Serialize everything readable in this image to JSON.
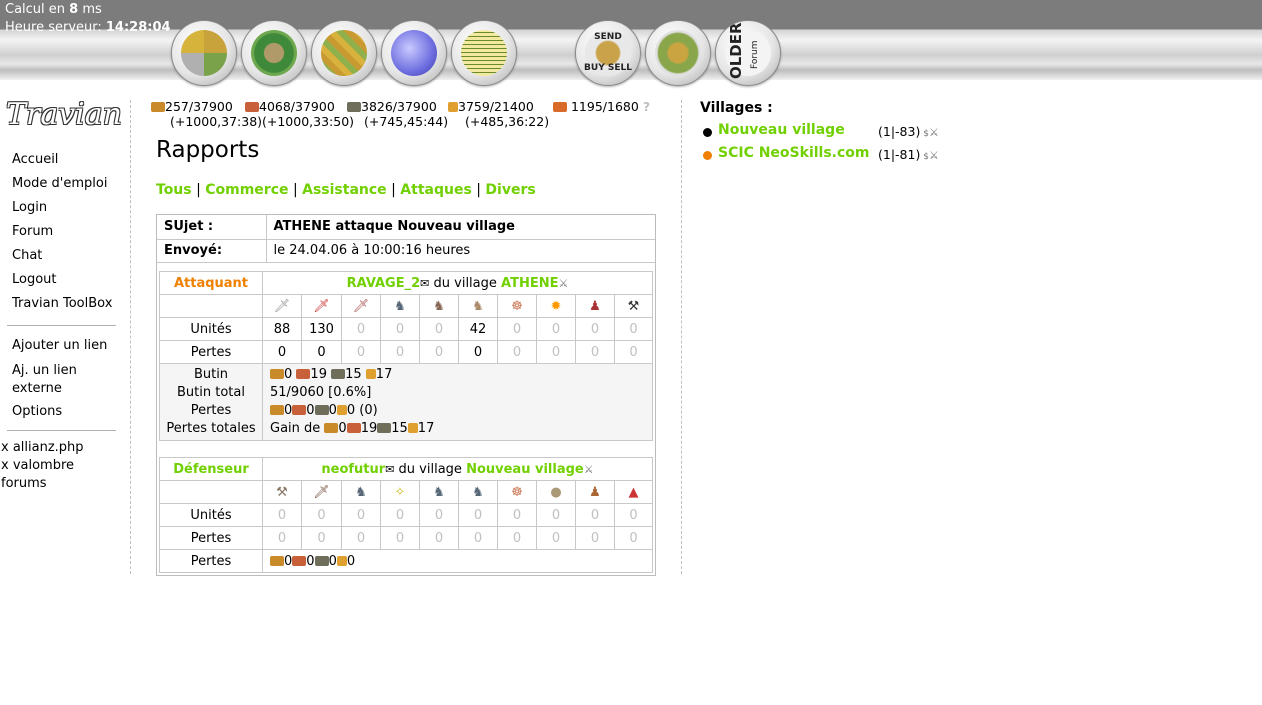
{
  "header": {
    "calc_label": "Calcul en",
    "calc_value": "8",
    "calc_unit": "ms",
    "server_time_label": "Heure serveur:",
    "server_time_value": "14:28:04",
    "nav": [
      {
        "name": "village-overview",
        "icon": "village-fields-icon"
      },
      {
        "name": "village-center",
        "icon": "village-center-icon"
      },
      {
        "name": "map",
        "icon": "map-icon"
      },
      {
        "name": "statistics",
        "icon": "statistics-icon"
      },
      {
        "name": "reports",
        "icon": "reports-icon"
      },
      {
        "name": "send-buy-sell",
        "icon": "marketplace-icon",
        "text_top": "SEND",
        "text_bottom": "BUY SELL"
      },
      {
        "name": "target-village",
        "icon": "target-village-icon"
      },
      {
        "name": "older-forum",
        "icon": "older-forum-icon",
        "text": "OLDER",
        "text2": "Forum"
      }
    ]
  },
  "sidebar": {
    "logo_text": "Travian",
    "menu": [
      "Accueil",
      "Mode d'emploi",
      "Login",
      "Forum",
      "Chat",
      "Logout",
      "Travian ToolBox"
    ],
    "menu2": [
      "Ajouter un lien",
      "Aj. un lien externe",
      "Options"
    ],
    "extra": [
      "x allianz.php",
      "x valombre forums"
    ]
  },
  "resources": {
    "wood": {
      "stock": "257/37900",
      "prod": "(+1000,37:38)"
    },
    "clay": {
      "stock": "4068/37900",
      "prod": "(+1000,33:50)"
    },
    "iron": {
      "stock": "3826/37900",
      "prod": "(+745,45:44)"
    },
    "crop": {
      "stock": "3759/21400",
      "prod": "(+485,36:22)"
    },
    "consumption": "1195/1680",
    "help": "?"
  },
  "page": {
    "title": "Rapports",
    "tabs": [
      "Tous",
      "Commerce",
      "Assistance",
      "Attaques",
      "Divers"
    ],
    "tab_sep": "|"
  },
  "report": {
    "subject_label": "SUjet :",
    "subject": "ATHENE attaque Nouveau village",
    "sent_label": "Envoyé:",
    "sent": "le 24.04.06 à 10:00:16 heures",
    "attacker": {
      "label": "Attaquant",
      "player": "RAVAGE_2",
      "from_village": "du village",
      "village": "ATHENE",
      "unit_icons": [
        "legionnaire-icon",
        "praetorian-icon",
        "imperian-icon",
        "equites-legati-icon",
        "equites-imperatoris-icon",
        "equites-caesaris-icon",
        "battering-ram-icon",
        "fire-catapult-icon",
        "senator-icon",
        "settler-icon"
      ],
      "units_label": "Unités",
      "units": [
        "88",
        "130",
        "0",
        "0",
        "0",
        "42",
        "0",
        "0",
        "0",
        "0"
      ],
      "losses_label": "Pertes",
      "losses": [
        "0",
        "0",
        "0",
        "0",
        "0",
        "0",
        "0",
        "0",
        "0",
        "0"
      ],
      "bounty_label": "Butin",
      "bounty": [
        "0",
        "19",
        "15",
        "17"
      ],
      "total_bounty_label": "Butin total",
      "total_bounty": "51/9060 [0.6%]",
      "res_losses_label": "Pertes",
      "res_losses": [
        "0",
        "0",
        "0",
        "0 (0)"
      ],
      "total_losses_label": "Pertes totales",
      "total_losses_prefix": "Gain de",
      "total_losses": [
        "0",
        "19",
        "15",
        "17"
      ]
    },
    "defender": {
      "label": "Défenseur",
      "player": "neofutur",
      "from_village": "du village",
      "village": "Nouveau village",
      "unit_icons": [
        "clubswinger-icon",
        "spearman-icon",
        "axeman-icon",
        "scout-icon",
        "paladin-icon",
        "teutonic-knight-icon",
        "ram-icon",
        "catapult-icon",
        "chief-icon",
        "settler-icon"
      ],
      "units_label": "Unités",
      "units": [
        "0",
        "0",
        "0",
        "0",
        "0",
        "0",
        "0",
        "0",
        "0",
        "0"
      ],
      "losses_label": "Pertes",
      "losses": [
        "0",
        "0",
        "0",
        "0",
        "0",
        "0",
        "0",
        "0",
        "0",
        "0"
      ],
      "res_losses_label": "Pertes",
      "res_losses": [
        "0",
        "0",
        "0",
        "0"
      ]
    }
  },
  "villages": {
    "title": "Villages :",
    "list": [
      {
        "name": "Nouveau village",
        "coords": "(1|-83)",
        "dot": "#000000"
      },
      {
        "name": "SCIC NeoSkills.com",
        "coords": "(1|-81)",
        "dot": "#f08000"
      }
    ]
  },
  "colors": {
    "link": "#71d000",
    "attacker": "#f08000"
  }
}
